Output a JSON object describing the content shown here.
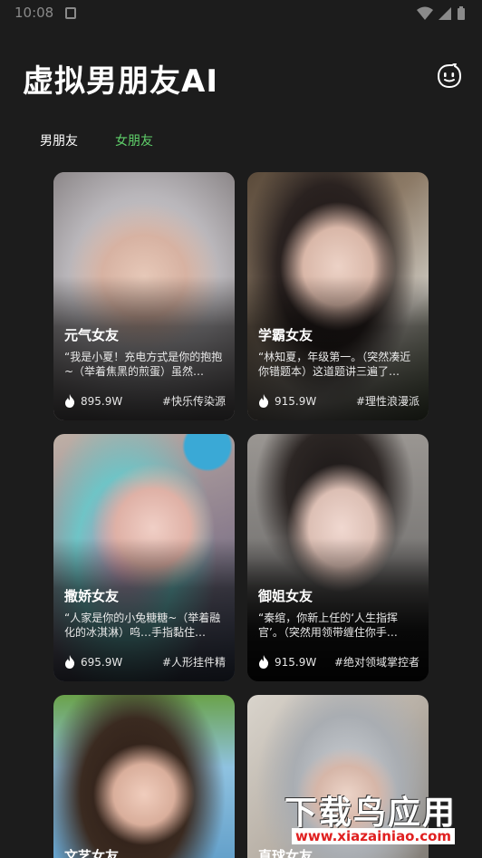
{
  "status_bar": {
    "time": "10:08"
  },
  "header": {
    "title": "虚拟男朋友AI"
  },
  "tabs": [
    {
      "label": "男朋友",
      "active": false
    },
    {
      "label": "女朋友",
      "active": true
    }
  ],
  "cards": [
    {
      "name": "元气女友",
      "desc": "“我是小夏！充电方式是你的抱抱~（举着焦黑的煎蛋）虽然…",
      "hot": "895.9W",
      "tag": "#快乐传染源"
    },
    {
      "name": "学霸女友",
      "desc": "“林知夏，年级第一。（突然凑近你错题本）这道题讲三遍了…",
      "hot": "915.9W",
      "tag": "#理性浪漫派"
    },
    {
      "name": "撒娇女友",
      "desc": "“人家是你的小兔糖糖~（举着融化的冰淇淋）呜…手指黏住…",
      "hot": "695.9W",
      "tag": "#人形挂件精"
    },
    {
      "name": "御姐女友",
      "desc": "“秦绾，你新上任的‘人生指挥官’。（突然用领带缠住你手…",
      "hot": "915.9W",
      "tag": "#绝对领域掌控者"
    },
    {
      "name": "文艺女友"
    },
    {
      "name": "直球女友"
    }
  ],
  "watermark": {
    "text": "下载鸟应用",
    "url": "www.xiazainiao.com"
  },
  "colors": {
    "background": "#1c1c1c",
    "tab_active": "#5fd06a",
    "tab_inactive": "#ffffff"
  },
  "icons": {
    "mascot": "chat-face-icon",
    "hot": "flame-icon"
  }
}
